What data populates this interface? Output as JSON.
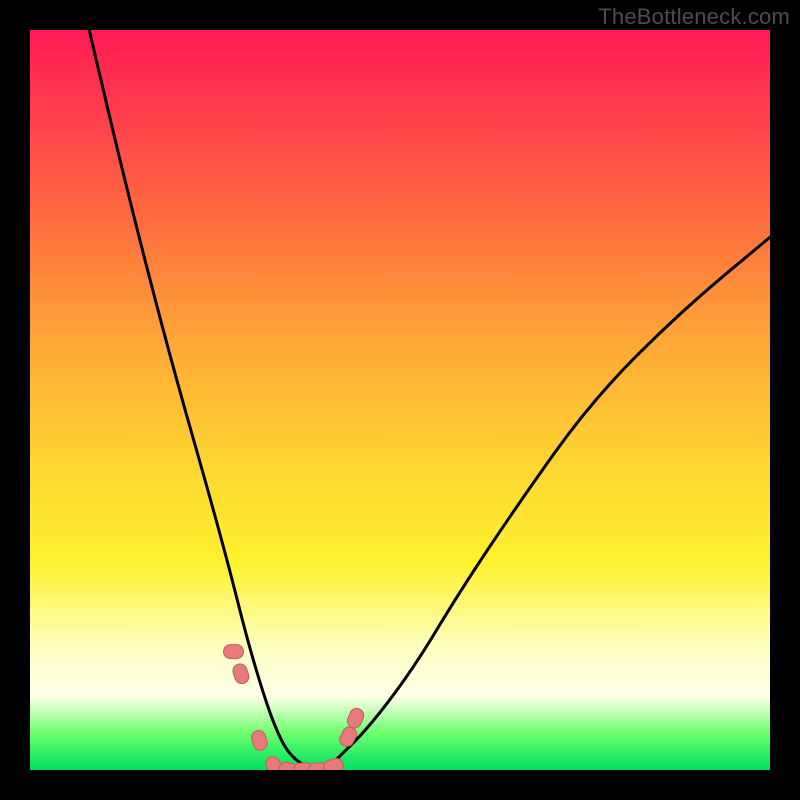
{
  "attribution": "TheBottleneck.com",
  "colors": {
    "frame": "#000000",
    "gradient_top": "#ff1a55",
    "gradient_mid": "#ffd433",
    "gradient_pale": "#ffffe8",
    "gradient_green": "#00e060",
    "curve_stroke": "#000000",
    "marker_fill": "#e77a7a",
    "marker_stroke": "#c85a5a"
  },
  "chart_data": {
    "type": "line",
    "title": "",
    "xlabel": "",
    "ylabel": "",
    "xlim": [
      0,
      100
    ],
    "ylim": [
      0,
      100
    ],
    "note": "Axes are unlabeled; values estimated as percentage of plot area (0 = left/bottom, 100 = right/top).",
    "series": [
      {
        "name": "bottleneck-curve",
        "x": [
          8,
          12,
          16,
          20,
          24,
          27,
          29,
          31,
          33,
          35,
          38,
          40,
          42,
          46,
          52,
          58,
          66,
          76,
          88,
          100
        ],
        "y": [
          100,
          83,
          67,
          52,
          38,
          27,
          19,
          12,
          6,
          2,
          0,
          0,
          2,
          6,
          14,
          24,
          36,
          50,
          62,
          72
        ]
      }
    ],
    "markers": {
      "name": "highlighted-points",
      "note": "Pink/coral rounded markers near the valley floor and lower slopes; positions estimated.",
      "x": [
        27.5,
        28.5,
        31,
        33,
        35,
        37,
        39,
        41,
        43,
        44
      ],
      "y": [
        16,
        13,
        4,
        0.5,
        0,
        0,
        0,
        0.5,
        4.5,
        7
      ]
    }
  }
}
